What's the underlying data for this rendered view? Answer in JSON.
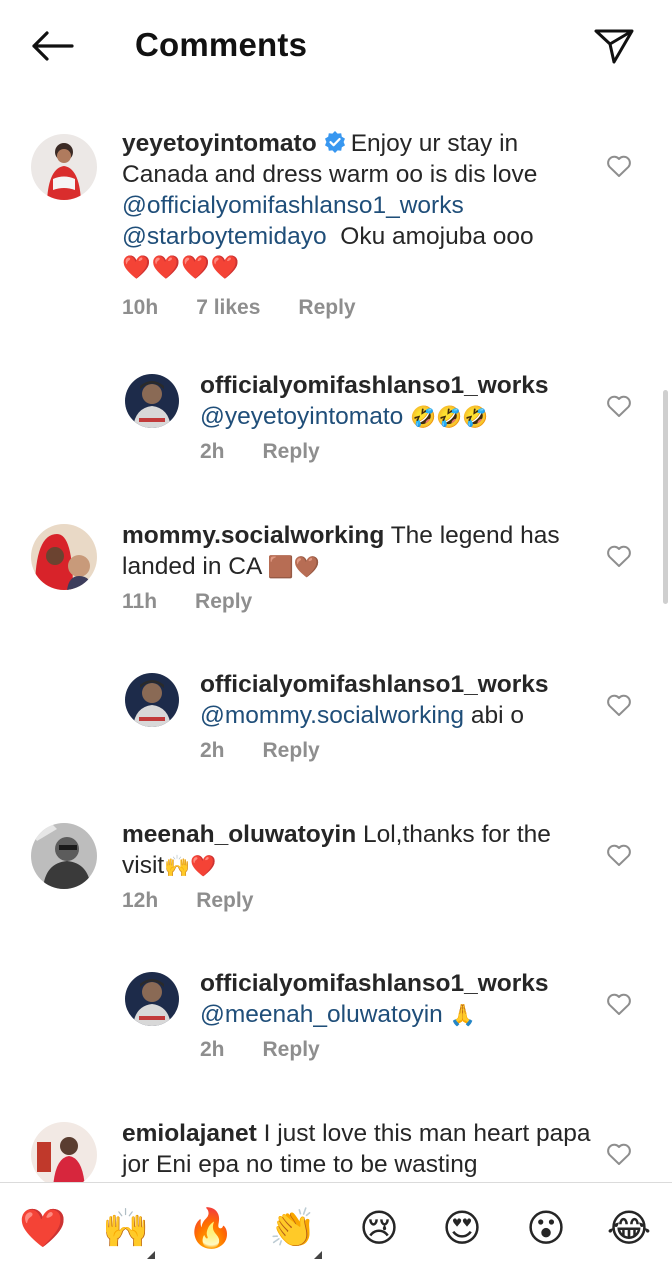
{
  "header": {
    "title": "Comments"
  },
  "comments": [
    {
      "username": "yeyetoyintomato",
      "verified": true,
      "text_before": "Enjoy ur stay in Canada and dress warm oo is dis love",
      "mention1": "@officialyomifashlanso1_works",
      "mention2": "@starboytemidayo",
      "text_after": "Oku amojuba ooo",
      "emoji": "❤️❤️❤️❤️",
      "time": "10h",
      "likes": "7 likes",
      "reply_label": "Reply"
    },
    {
      "username": "officialyomifashlanso1_works",
      "mention": "@yeyetoyintomato",
      "emoji": "🤣🤣🤣",
      "time": "2h",
      "reply_label": "Reply"
    },
    {
      "username": "mommy.socialworking",
      "text": "The legend has landed in CA",
      "emoji": "🟫🤎",
      "time": "11h",
      "reply_label": "Reply"
    },
    {
      "username": "officialyomifashlanso1_works",
      "mention": "@mommy.socialworking",
      "text": "abi o",
      "time": "2h",
      "reply_label": "Reply"
    },
    {
      "username": "meenah_oluwatoyin",
      "text": "Lol,thanks for the visit",
      "emoji": "🙌❤️",
      "time": "12h",
      "reply_label": "Reply"
    },
    {
      "username": "officialyomifashlanso1_works",
      "mention": "@meenah_oluwatoyin",
      "emoji": "🙏",
      "time": "2h",
      "reply_label": "Reply"
    },
    {
      "username": "emiolajanet",
      "text": "I just love this man heart papa jor Eni epa no time to be wasting"
    }
  ],
  "reactions": [
    "❤️",
    "🙌",
    "🔥",
    "👏",
    "😢",
    "😍",
    "😮",
    "😂"
  ],
  "icons": {
    "back": "arrow-left-icon",
    "send": "paper-plane-icon",
    "like": "heart-outline-icon",
    "verified": "verified-badge-icon"
  },
  "colors": {
    "mention": "#1f4e79",
    "verified": "#3897f0",
    "meta": "#8e8e8e"
  }
}
